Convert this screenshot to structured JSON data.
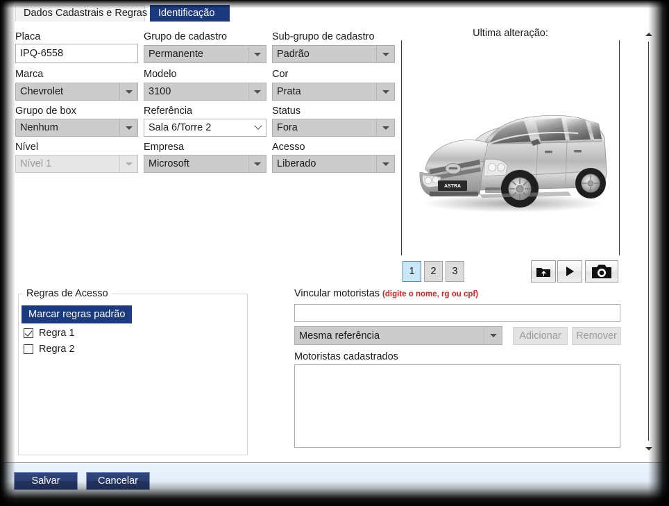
{
  "tabs": [
    {
      "label": "Dados Cadastrais e Regras",
      "selected": false
    },
    {
      "label": "Identificação",
      "selected": true
    }
  ],
  "form": {
    "fields": [
      {
        "label": "Placa",
        "value": "IPQ-6558",
        "type": "textbox",
        "disabled": false,
        "name": "placa"
      },
      {
        "label": "Grupo de cadastro",
        "value": "Permanente",
        "type": "combo",
        "disabled": false,
        "name": "grupo-de-cadastro"
      },
      {
        "label": "Sub-grupo de cadastro",
        "value": "Padrão",
        "type": "combo",
        "disabled": false,
        "name": "sub-grupo-de-cadastro"
      },
      {
        "label": "Marca",
        "value": "Chevrolet",
        "type": "combo",
        "disabled": false,
        "name": "marca"
      },
      {
        "label": "Modelo",
        "value": "3100",
        "type": "combo",
        "disabled": false,
        "name": "modelo"
      },
      {
        "label": "Cor",
        "value": "Prata",
        "type": "combo",
        "disabled": false,
        "name": "cor"
      },
      {
        "label": "Grupo de box",
        "value": "Nenhum",
        "type": "combo",
        "disabled": false,
        "name": "grupo-de-box"
      },
      {
        "label": "Referência",
        "value": "Sala 6/Torre 2",
        "type": "editable",
        "disabled": false,
        "name": "referencia"
      },
      {
        "label": "Status",
        "value": "Fora",
        "type": "combo",
        "disabled": false,
        "name": "status"
      },
      {
        "label": "Nível",
        "value": "Nível 1",
        "type": "combo",
        "disabled": true,
        "name": "nivel"
      },
      {
        "label": "Empresa",
        "value": "Microsoft",
        "type": "combo",
        "disabled": false,
        "name": "empresa"
      },
      {
        "label": "Acesso",
        "value": "Liberado",
        "type": "combo",
        "disabled": false,
        "name": "acesso"
      }
    ]
  },
  "image_panel": {
    "title": "Ultima alteração:",
    "photo_alt": "silver Chevrolet Astra sedan",
    "photo_badge": "ASTRA",
    "pages": [
      {
        "label": "1",
        "active": true
      },
      {
        "label": "2",
        "active": false
      },
      {
        "label": "3",
        "active": false
      }
    ],
    "media_buttons": [
      {
        "icon": "folder-upload-icon"
      },
      {
        "icon": "play-icon"
      },
      {
        "icon": "camera-icon"
      }
    ]
  },
  "rules": {
    "legend": "Regras de Acesso",
    "default_button": "Marcar regras padrão",
    "items": [
      {
        "label": "Regra 1",
        "checked": true
      },
      {
        "label": "Regra 2",
        "checked": false
      }
    ]
  },
  "drivers": {
    "link_label": "Vincular motoristas",
    "link_hint": "(digite o nome, rg ou cpf)",
    "search_value": "",
    "search_placeholder": "",
    "scope_value": "Mesma referência",
    "add_label": "Adicionar",
    "remove_label": "Remover",
    "registered_label": "Motoristas cadastrados",
    "registered_items": []
  },
  "footer": {
    "save_label": "Salvar",
    "cancel_label": "Cancelar"
  },
  "colors": {
    "accent_blue": "#1b3a80",
    "selected_page": "#cbe6f7",
    "hint_red": "#e01b1b"
  }
}
